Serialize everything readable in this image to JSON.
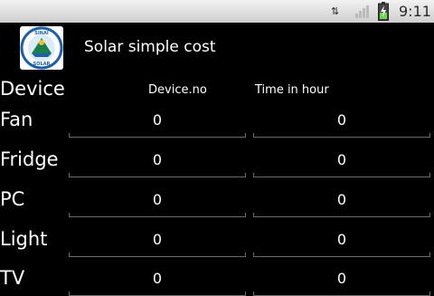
{
  "status_bar": {
    "time": "9:11",
    "network_icon": "data-transfer-icon",
    "signal_icon": "signal-icon",
    "battery_icon": "battery-charging-icon"
  },
  "header": {
    "logo_text_top": "SINAI",
    "logo_text_bottom": "SOLAR",
    "title": "Solar simple cost"
  },
  "table": {
    "device_header": "Device",
    "columns": [
      "Device.no",
      "Time in hour"
    ],
    "rows": [
      {
        "label": "Fan",
        "device_no": "0",
        "time_in_hour": "0"
      },
      {
        "label": "Fridge",
        "device_no": "0",
        "time_in_hour": "0"
      },
      {
        "label": "PC",
        "device_no": "0",
        "time_in_hour": "0"
      },
      {
        "label": "Light",
        "device_no": "0",
        "time_in_hour": "0"
      },
      {
        "label": "TV",
        "device_no": "0",
        "time_in_hour": "0"
      }
    ]
  }
}
